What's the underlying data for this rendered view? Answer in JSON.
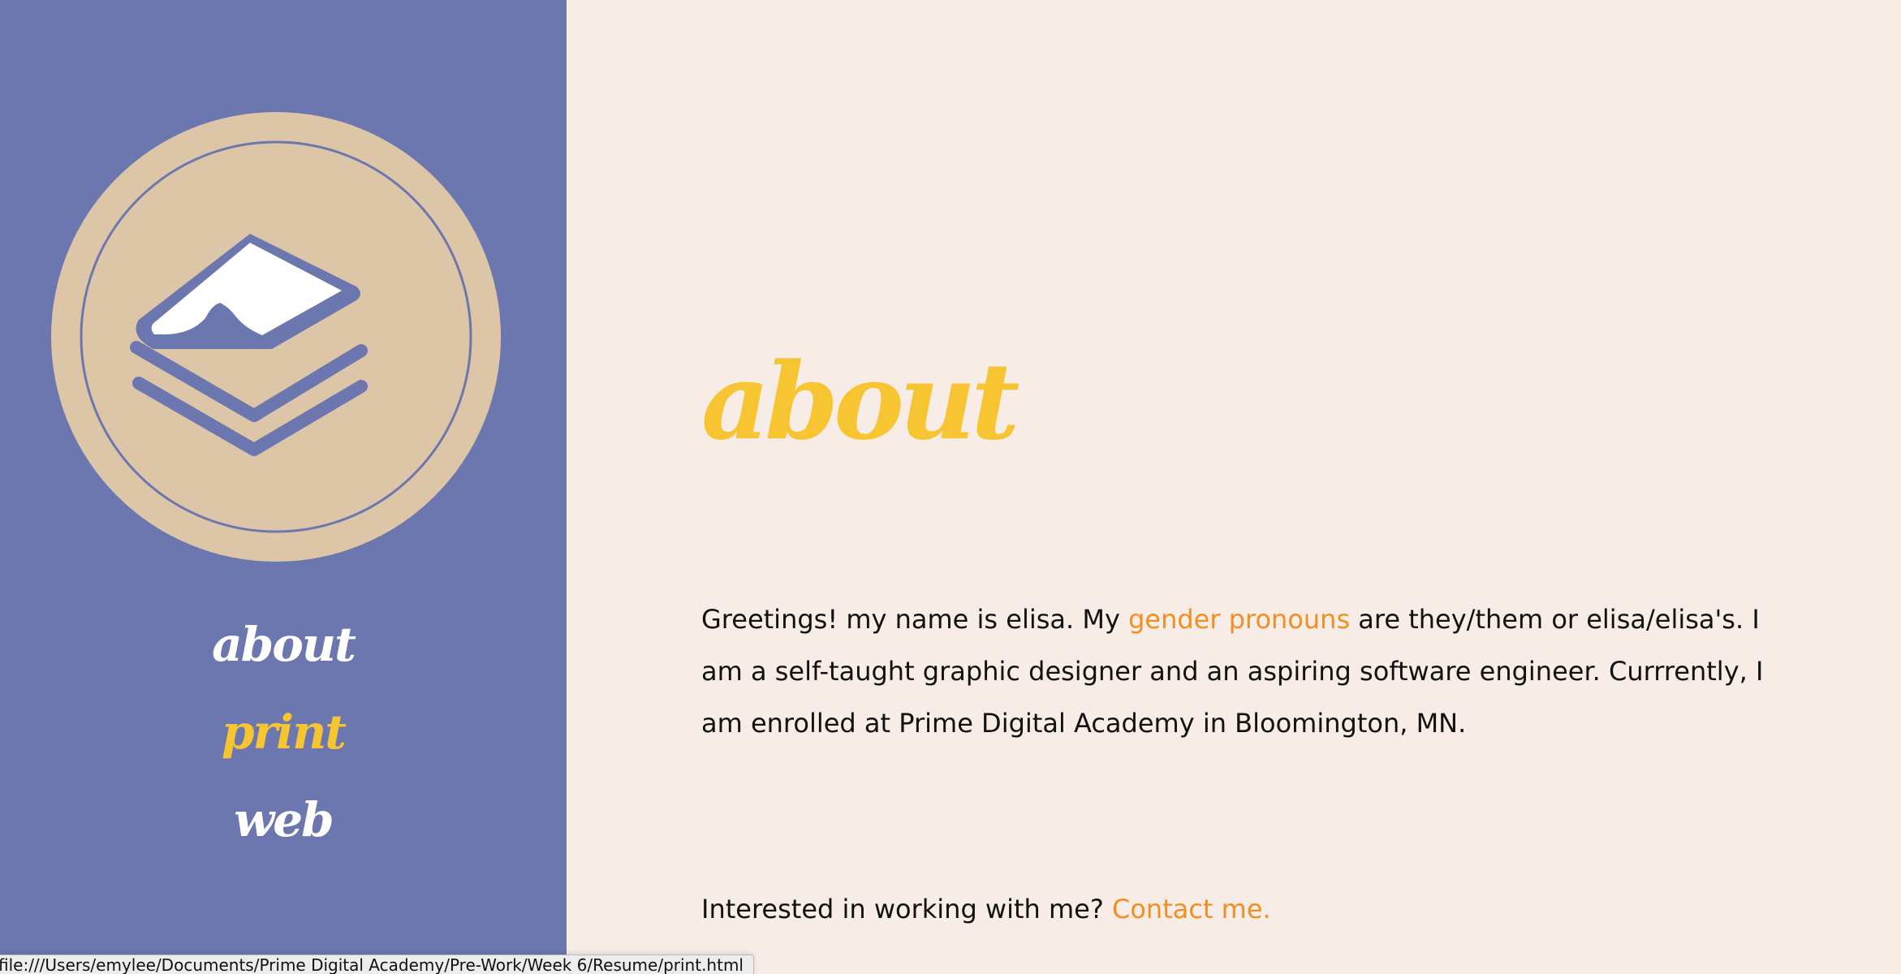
{
  "sidebar": {
    "logo_icon": "stacked-paper-logo-icon",
    "nav": [
      {
        "label": "about"
      },
      {
        "label": "print",
        "active": true
      },
      {
        "label": "web"
      }
    ]
  },
  "main": {
    "title": "about",
    "bio": {
      "before_link": "Greetings! my name is elisa. My ",
      "link": "gender pronouns",
      "after_link": " are they/them or elisa/elisa's. I am a self-taught graphic designer and an aspiring software engineer. Currrently, I am enrolled at Prime Digital Academy in Bloomington, MN."
    },
    "contact": {
      "prompt": "Interested in working with me? ",
      "link": "Contact me."
    }
  },
  "status_bar": {
    "url": "file:///Users/emylee/Documents/Prime Digital Academy/Pre-Work/Week 6/Resume/print.html"
  },
  "colors": {
    "sidebar_bg": "#6b77ae",
    "page_bg": "#f7ece6",
    "accent_yellow": "#f6c531",
    "link_orange": "#f28f22",
    "logo_circle": "#ddc6a8"
  }
}
